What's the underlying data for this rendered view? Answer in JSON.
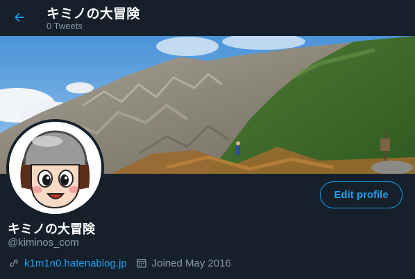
{
  "header": {
    "title": "キミノの大冒険",
    "subtitle": "0 Tweets",
    "back_icon": "arrow-left-icon"
  },
  "profile": {
    "display_name": "キミノの大冒険",
    "handle": "@kiminos_com",
    "website": "k1m1n0.hatenablog.jp",
    "joined": "Joined May 2016",
    "edit_label": "Edit profile"
  },
  "icons": {
    "link": "link-icon",
    "calendar": "calendar-icon"
  },
  "colors": {
    "background": "#15202b",
    "accent": "#1da1f2",
    "secondary_text": "#8899a6"
  }
}
